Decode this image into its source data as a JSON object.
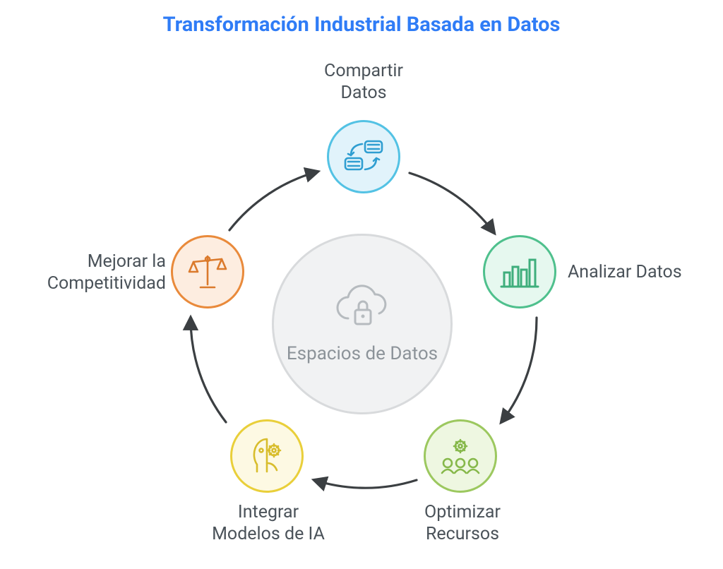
{
  "title": "Transformación Industrial Basada en Datos",
  "center": {
    "label": "Espacios de\nDatos",
    "icon": "cloud-lock-icon"
  },
  "nodes": {
    "share": {
      "label": "Compartir\nDatos",
      "icon": "data-exchange-icon",
      "color_border": "#53c2e4",
      "color_fill": "#e1f3fb"
    },
    "analyze": {
      "label": "Analizar Datos",
      "icon": "bar-chart-icon",
      "color_border": "#4fc08d",
      "color_fill": "#e6f8ef"
    },
    "optimize": {
      "label": "Optimizar\nRecursos",
      "icon": "team-gear-icon",
      "color_border": "#9cc85f",
      "color_fill": "#eef7e1"
    },
    "integrate": {
      "label": "Integrar\nModelos de IA",
      "icon": "ai-head-gear-icon",
      "color_border": "#e9cf3a",
      "color_fill": "#fdf9e3"
    },
    "improve": {
      "label": "Mejorar la\nCompetitividad",
      "icon": "scales-icon",
      "color_border": "#e98a3b",
      "color_fill": "#fdede0"
    }
  },
  "cycle_order": [
    "share",
    "analyze",
    "optimize",
    "integrate",
    "improve"
  ],
  "colors": {
    "title": "#2f7cf6",
    "text": "#4a5259",
    "center_text": "#8c9399",
    "center_fill": "#f1f2f3",
    "center_border": "#d8dadc",
    "arrow": "#3b3f42"
  }
}
